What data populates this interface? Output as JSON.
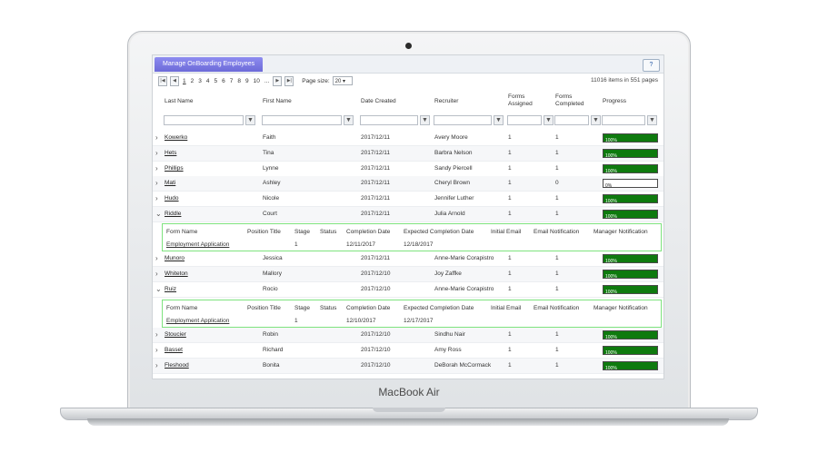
{
  "device": {
    "brand": "MacBook Air"
  },
  "window": {
    "tab_title": "Manage OnBoarding Employees",
    "help_label": "?"
  },
  "pager": {
    "first": "|◀",
    "prev": "◀",
    "next": "▶",
    "last": "▶|",
    "pages": [
      "1",
      "2",
      "3",
      "4",
      "5",
      "6",
      "7",
      "8",
      "9",
      "10",
      "..."
    ],
    "page_size_label": "Page size:",
    "page_size_value": "20",
    "items_info": "11016 items in 551 pages"
  },
  "columns": {
    "last_name": "Last Name",
    "first_name": "First Name",
    "date_created": "Date Created",
    "recruiter": "Recruiter",
    "forms_assigned": "Forms Assigned",
    "forms_completed": "Forms Completed",
    "progress": "Progress"
  },
  "filter_icon": "funnel-icon",
  "rows": [
    {
      "last": "Kowerko",
      "first": "Faith",
      "date": "2017/12/11",
      "recruiter": "Avery Moore",
      "assigned": "1",
      "completed": "1",
      "progress": 1.0,
      "progress_label": "100%",
      "expand": "›"
    },
    {
      "last": "Hets",
      "first": "Tina",
      "date": "2017/12/11",
      "recruiter": "Barbra Nelson",
      "assigned": "1",
      "completed": "1",
      "progress": 1.0,
      "progress_label": "100%",
      "expand": "›"
    },
    {
      "last": "Phillips",
      "first": "Lynne",
      "date": "2017/12/11",
      "recruiter": "Sandy Piercell",
      "assigned": "1",
      "completed": "1",
      "progress": 1.0,
      "progress_label": "100%",
      "expand": "›"
    },
    {
      "last": "Mati",
      "first": "Ashley",
      "date": "2017/12/11",
      "recruiter": "Cheryl Brown",
      "assigned": "1",
      "completed": "0",
      "progress": 0.0,
      "progress_label": "0%",
      "expand": "›"
    },
    {
      "last": "Hudo",
      "first": "Nicole",
      "date": "2017/12/11",
      "recruiter": "Jennifer Luther",
      "assigned": "1",
      "completed": "1",
      "progress": 1.0,
      "progress_label": "100%",
      "expand": "›"
    },
    {
      "last": "Riddle",
      "first": "Court",
      "date": "2017/12/11",
      "recruiter": "Julia Arnold",
      "assigned": "1",
      "completed": "1",
      "progress": 1.0,
      "progress_label": "100%",
      "expand": "⌄"
    },
    {
      "last": "Munoro",
      "first": "Jessica",
      "date": "2017/12/11",
      "recruiter": "Anne-Marie Corapistro",
      "assigned": "1",
      "completed": "1",
      "progress": 1.0,
      "progress_label": "100%",
      "expand": "›"
    },
    {
      "last": "Whiteton",
      "first": "Mallory",
      "date": "2017/12/10",
      "recruiter": "Joy Zaffke",
      "assigned": "1",
      "completed": "1",
      "progress": 1.0,
      "progress_label": "100%",
      "expand": "›"
    },
    {
      "last": "Ruiz",
      "first": "Rocio",
      "date": "2017/12/10",
      "recruiter": "Anne-Marie Corapistro",
      "assigned": "1",
      "completed": "1",
      "progress": 1.0,
      "progress_label": "100%",
      "expand": "⌄"
    },
    {
      "last": "Stoucier",
      "first": "Robin",
      "date": "2017/12/10",
      "recruiter": "Sindhu Nair",
      "assigned": "1",
      "completed": "1",
      "progress": 1.0,
      "progress_label": "100%",
      "expand": "›"
    },
    {
      "last": "Basset",
      "first": "Richard",
      "date": "2017/12/10",
      "recruiter": "Amy Ross",
      "assigned": "1",
      "completed": "1",
      "progress": 1.0,
      "progress_label": "100%",
      "expand": "›"
    },
    {
      "last": "Fleshood",
      "first": "Bonita",
      "date": "2017/12/10",
      "recruiter": "DeBorah McCormack",
      "assigned": "1",
      "completed": "1",
      "progress": 1.0,
      "progress_label": "100%",
      "expand": "›"
    }
  ],
  "detail_headers": {
    "form_name": "Form Name",
    "position_title": "Position Title",
    "stage": "Stage",
    "status": "Status",
    "completion_date": "Completion Date",
    "expected_completion_date": "Expected Completion Date",
    "initial_email": "Initial Email",
    "email_notification": "Email Notification",
    "manager_notification": "Manager Notification"
  },
  "details": [
    {
      "form_name": "Employment Application",
      "stage": "1",
      "completion_date": "12/11/2017",
      "expected": "12/18/2017"
    },
    {
      "form_name": "Employment Application",
      "stage": "1",
      "completion_date": "12/10/2017",
      "expected": "12/17/2017"
    }
  ],
  "colors": {
    "progress_fill": "#0e7a0e",
    "detail_border": "#7ee37e",
    "tab": "#7a78e4"
  }
}
